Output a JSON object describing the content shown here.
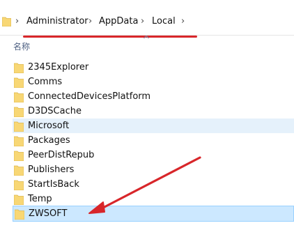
{
  "breadcrumb": {
    "items": [
      "Administrator",
      "AppData",
      "Local"
    ]
  },
  "list_header": {
    "name_column": "名称"
  },
  "files": [
    {
      "name": "2345Explorer",
      "state": "normal"
    },
    {
      "name": "Comms",
      "state": "normal"
    },
    {
      "name": "ConnectedDevicesPlatform",
      "state": "normal"
    },
    {
      "name": "D3DSCache",
      "state": "normal"
    },
    {
      "name": "Microsoft",
      "state": "hover"
    },
    {
      "name": "Packages",
      "state": "normal"
    },
    {
      "name": "PeerDistRepub",
      "state": "normal"
    },
    {
      "name": "Publishers",
      "state": "normal"
    },
    {
      "name": "StartIsBack",
      "state": "normal"
    },
    {
      "name": "Temp",
      "state": "normal"
    },
    {
      "name": "ZWSOFT",
      "state": "selected"
    }
  ],
  "icons": {
    "folder": "folder-icon",
    "chevron": "chevron-right-icon"
  },
  "colors": {
    "annotation_red": "#d8262a",
    "folder_yellow": "#f8d775",
    "hover_bg": "#e5f1fb",
    "selected_bg": "#cce8ff"
  }
}
